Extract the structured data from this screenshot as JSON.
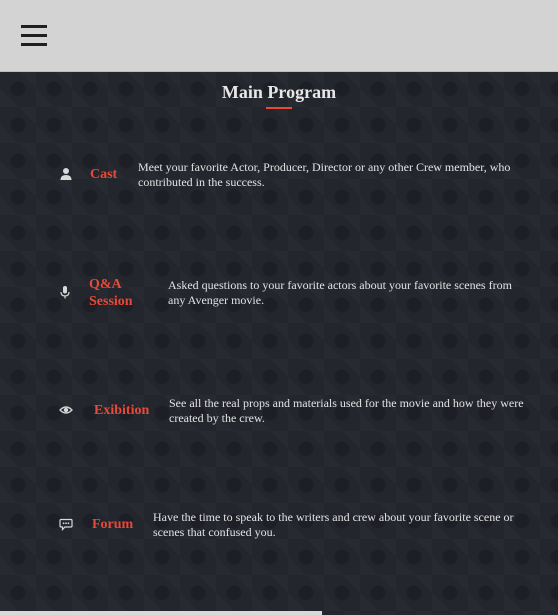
{
  "header": {
    "menu_icon": "hamburger-menu-icon"
  },
  "main": {
    "title": "Main Program",
    "items": [
      {
        "icon": "user-icon",
        "label": "Cast",
        "description": "Meet your favorite Actor, Producer, Director or any other Crew member, who contributed in the success."
      },
      {
        "icon": "microphone-icon",
        "label": "Q&A Session",
        "description": "Asked questions to your favorite actors about your favorite scenes from any Avenger movie."
      },
      {
        "icon": "eye-icon",
        "label": "Exibition",
        "description": "See all the real props and materials used for the movie and how they were created by the crew."
      },
      {
        "icon": "chat-bubble-icon",
        "label": "Forum",
        "description": "Have the time to speak to the writers and crew about your favorite scene or scenes that confused you."
      }
    ]
  },
  "colors": {
    "accent": "#e84a37",
    "background": "#24262e",
    "header": "#d3d3d3"
  }
}
